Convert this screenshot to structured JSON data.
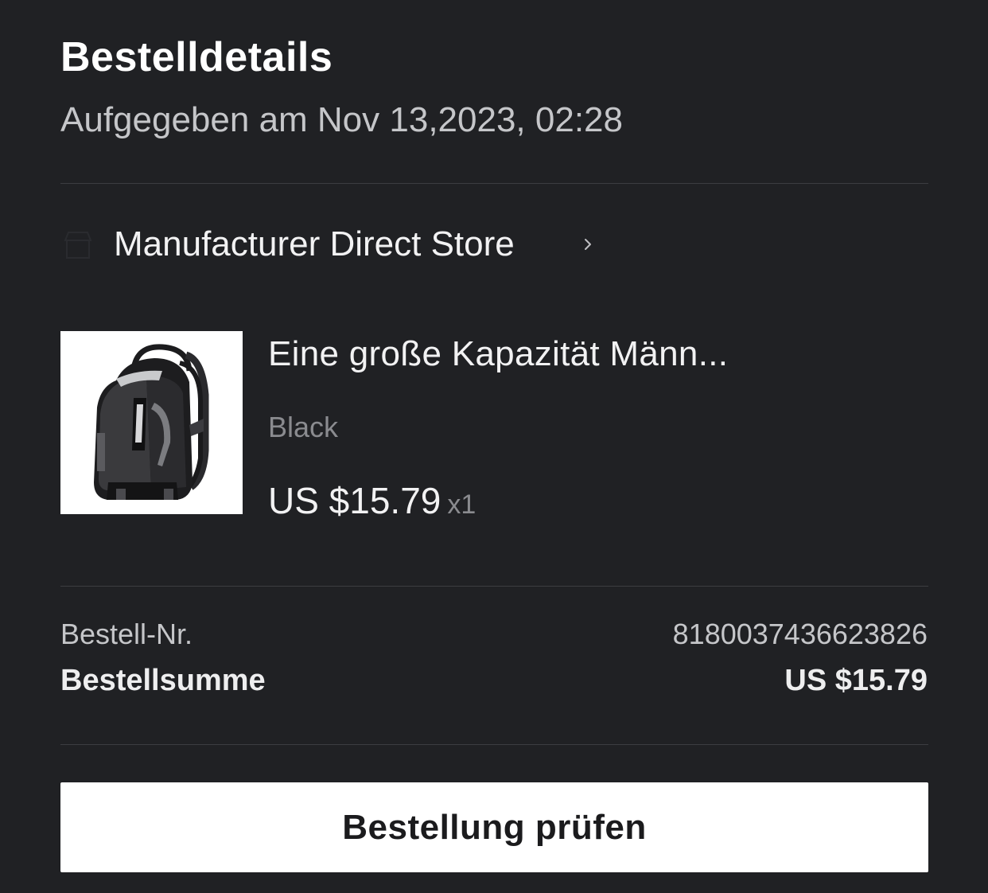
{
  "header": {
    "title": "Bestelldetails",
    "placed_at": "Aufgegeben am Nov 13,2023, 02:28"
  },
  "store": {
    "name": "Manufacturer Direct Store",
    "icon": "store-icon",
    "chevron_icon": "chevron-right-icon"
  },
  "product": {
    "title": "Eine große Kapazität Männ...",
    "variant": "Black",
    "price": "US $15.79",
    "quantity": "x1",
    "image": "black-backpack-image"
  },
  "summary": {
    "order_number_label": "Bestell-Nr.",
    "order_number_value": "8180037436623826",
    "total_label": "Bestellsumme",
    "total_value": "US $15.79"
  },
  "actions": {
    "review_button_label": "Bestellung prüfen"
  },
  "colors": {
    "background": "#202124",
    "primary_text": "#ffffff",
    "secondary_text": "#c5c6c9",
    "muted_text": "#8a8b8f",
    "divider": "#3c3d41",
    "button_background": "#ffffff",
    "button_text": "#1b1b1d"
  }
}
